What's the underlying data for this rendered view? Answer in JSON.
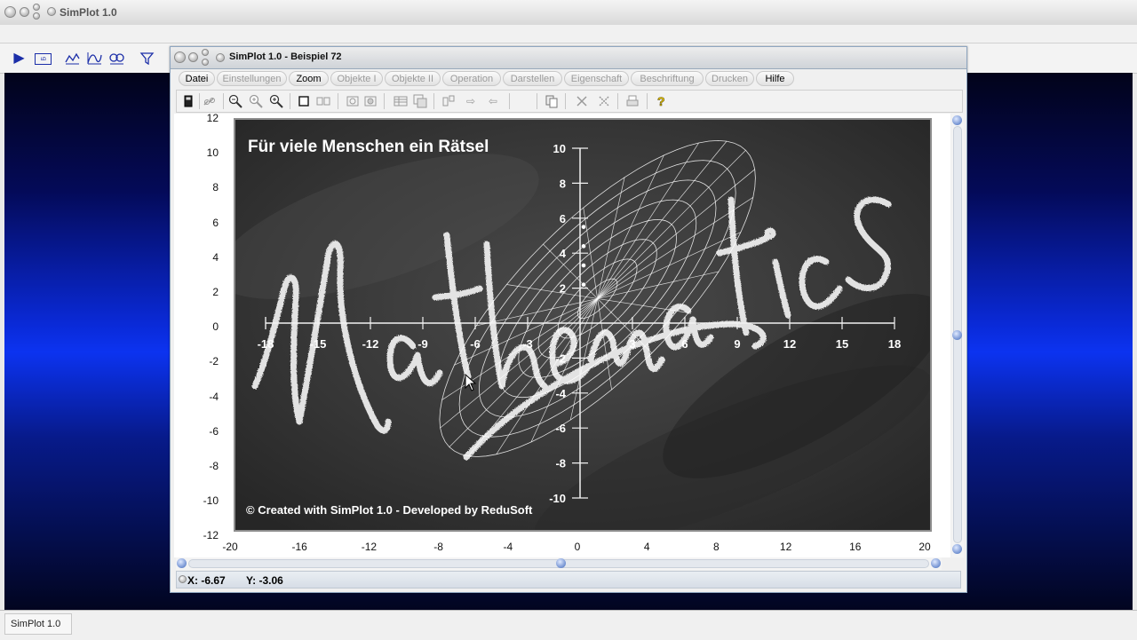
{
  "app": {
    "title": "SimPlot 1.0",
    "status_cell": "SimPlot 1.0"
  },
  "main_toolbar": {
    "icons": [
      "play-icon",
      "window-icon",
      "line-chart-icon",
      "xy-plot-icon",
      "zoom-plot-icon",
      "filter-icon"
    ]
  },
  "child": {
    "title": "SimPlot 1.0 - Beispiel 72",
    "menu": [
      {
        "label": "Datei",
        "enabled": true
      },
      {
        "label": "Einstellungen",
        "enabled": false
      },
      {
        "label": "Zoom",
        "enabled": true
      },
      {
        "label": "Objekte I",
        "enabled": false
      },
      {
        "label": "Objekte II",
        "enabled": false
      },
      {
        "label": "Operation",
        "enabled": false
      },
      {
        "label": "Darstellen",
        "enabled": false
      },
      {
        "label": "Eigenschaft",
        "enabled": false
      },
      {
        "label": "Beschriftung",
        "enabled": false
      },
      {
        "label": "Drucken",
        "enabled": false
      },
      {
        "label": "Hilfe",
        "enabled": true
      }
    ],
    "toolbar_icons": [
      "calculator-icon",
      "link-icon",
      "zoom-in-icon",
      "zoom-out-icon",
      "zoom-fit-icon",
      "square-icon",
      "compare-icon",
      "window-small-icon",
      "window-restore-icon",
      "table-icon",
      "transform-icon",
      "split-icon",
      "arrow-right-icon",
      "arrow-left-icon",
      "copy-icon",
      "cross-icon",
      "cross-dotted-icon",
      "print-icon",
      "help-icon"
    ],
    "status": {
      "x_label": "X:",
      "x_value": "-6.67",
      "y_label": "Y:",
      "y_value": "-3.06"
    }
  },
  "outer_axes": {
    "y_ticks": [
      "12",
      "10",
      "8",
      "6",
      "4",
      "2",
      "0",
      "-2",
      "-4",
      "-6",
      "-8",
      "-10",
      "-12"
    ],
    "x_ticks": [
      "-20",
      "-16",
      "-12",
      "-8",
      "-4",
      "0",
      "4",
      "8",
      "12",
      "16",
      "20"
    ]
  },
  "board": {
    "heading": "Für viele Menschen ein Rätsel",
    "chalk_word": "Mathematics",
    "credit": "© Created with SimPlot 1.0 - Developed by ReduSoft",
    "colors": {
      "chalk": "#f2f2f2",
      "board": "#3a3a3a"
    }
  },
  "chart_data": {
    "type": "line",
    "x_ticks": [
      "-18",
      "-15",
      "-12",
      "-9",
      "-6",
      "-3",
      "3",
      "6",
      "9",
      "12",
      "15",
      "18"
    ],
    "y_ticks": [
      "10",
      "8",
      "6",
      "4",
      "2",
      "-2",
      "-4",
      "-6",
      "-8",
      "-10"
    ],
    "xlim": [
      -18,
      18
    ],
    "ylim": [
      -10,
      10
    ],
    "grid": false,
    "marked_points": [
      {
        "x": 0,
        "y": 5.5
      },
      {
        "x": 0,
        "y": 4.4
      },
      {
        "x": 0,
        "y": 3.3
      },
      {
        "x": 0,
        "y": 2.2
      }
    ],
    "surface": {
      "center": [
        1,
        1.4
      ],
      "rotation_deg": 45,
      "radius_major": 12,
      "radius_minor": 4.4,
      "rings": 8,
      "spokes": 24
    }
  }
}
